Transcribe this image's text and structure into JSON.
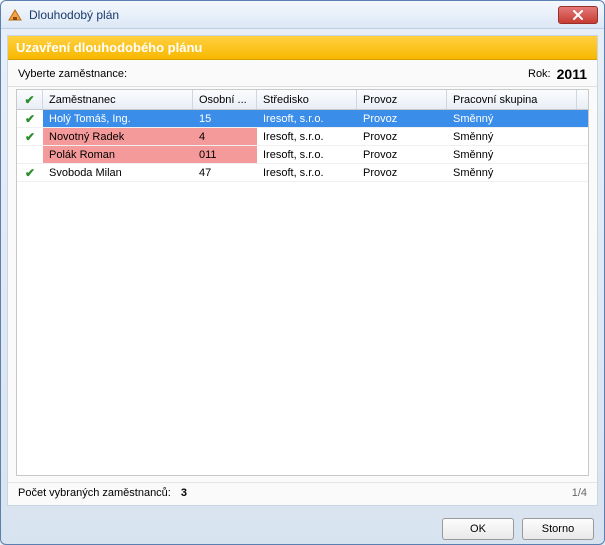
{
  "window": {
    "title": "Dlouhodobý plán"
  },
  "banner": "Uzavření dlouhodobého plánu",
  "select": {
    "label": "Vyberte zaměstnance:",
    "year_label": "Rok:",
    "year": "2011"
  },
  "columns": {
    "name": "Zaměstnanec",
    "pers": "Osobní ...",
    "stred": "Středisko",
    "prov": "Provoz",
    "skup": "Pracovní skupina"
  },
  "check_glyph": "✔",
  "rows": [
    {
      "checked": true,
      "name": "Holý Tomáš, Ing.",
      "pers": "15",
      "stred": "Iresoft, s.r.o.",
      "prov": "Provoz",
      "skup": "Směnný",
      "selected": true,
      "flagged": false
    },
    {
      "checked": true,
      "name": "Novotný Radek",
      "pers": "4",
      "stred": "Iresoft, s.r.o.",
      "prov": "Provoz",
      "skup": "Směnný",
      "selected": false,
      "flagged": true
    },
    {
      "checked": false,
      "name": "Polák Roman",
      "pers": "011",
      "stred": "Iresoft, s.r.o.",
      "prov": "Provoz",
      "skup": "Směnný",
      "selected": false,
      "flagged": true
    },
    {
      "checked": true,
      "name": "Svoboda Milan",
      "pers": "47",
      "stred": "Iresoft, s.r.o.",
      "prov": "Provoz",
      "skup": "Směnný",
      "selected": false,
      "flagged": false
    }
  ],
  "footer": {
    "count_label": "Počet vybraných zaměstnanců:",
    "count": "3",
    "page": "1/4"
  },
  "buttons": {
    "ok": "OK",
    "cancel": "Storno"
  }
}
